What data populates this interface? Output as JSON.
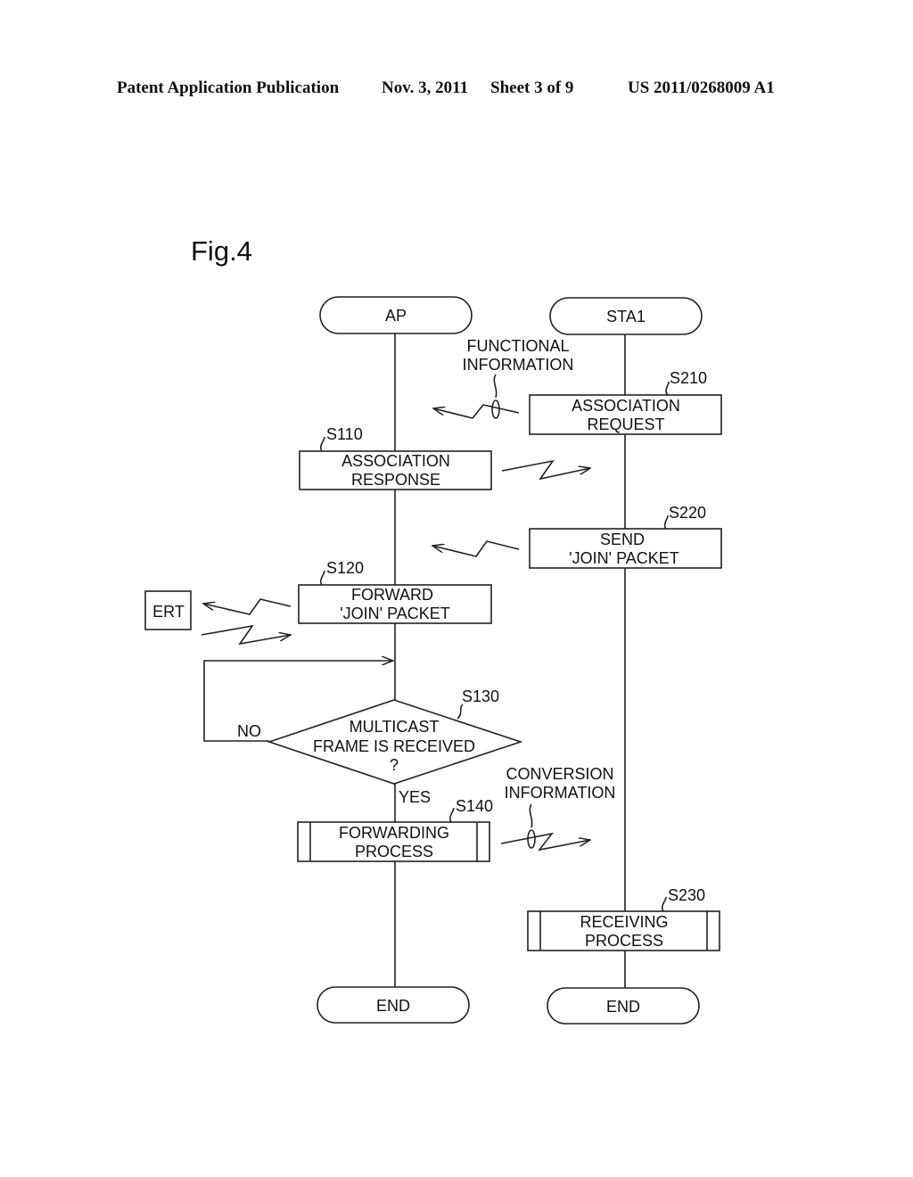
{
  "header": {
    "publication": "Patent Application Publication",
    "date": "Nov. 3, 2011",
    "sheet": "Sheet 3 of 9",
    "number": "US 2011/0268009 A1"
  },
  "figure": {
    "title": "Fig.4",
    "lanes": {
      "ap": {
        "start": "AP",
        "end": "END"
      },
      "sta": {
        "start": "STA1",
        "end": "END"
      }
    },
    "external": "ERT",
    "steps": {
      "s110": {
        "ref": "S110",
        "line1": "ASSOCIATION",
        "line2": "RESPONSE"
      },
      "s120": {
        "ref": "S120",
        "line1": "FORWARD",
        "line2": "'JOIN' PACKET"
      },
      "s130": {
        "ref": "S130",
        "line1": "MULTICAST",
        "line2": "FRAME IS RECEIVED",
        "line3": "?",
        "no": "NO",
        "yes": "YES"
      },
      "s140": {
        "ref": "S140",
        "line1": "FORWARDING",
        "line2": "PROCESS"
      },
      "s210": {
        "ref": "S210",
        "line1": "ASSOCIATION",
        "line2": "REQUEST"
      },
      "s220": {
        "ref": "S220",
        "line1": "SEND",
        "line2": "'JOIN' PACKET"
      },
      "s230": {
        "ref": "S230",
        "line1": "RECEIVING",
        "line2": "PROCESS"
      }
    },
    "annotations": {
      "functional": {
        "line1": "FUNCTIONAL",
        "line2": "INFORMATION"
      },
      "conversion": {
        "line1": "CONVERSION",
        "line2": "INFORMATION"
      }
    }
  }
}
